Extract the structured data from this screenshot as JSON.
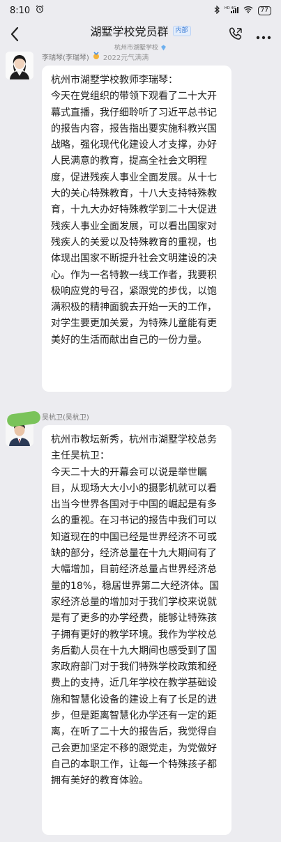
{
  "status_bar": {
    "time": "8:10",
    "network": "HD 4G",
    "battery": "77"
  },
  "header": {
    "title": "湖墅学校党员群",
    "tag": "内部",
    "subtitle": "杭州市湖墅学校"
  },
  "messages": [
    {
      "sender": "李瑞琴(李瑞琴)",
      "badge_text": "2022元气满满",
      "lines": [
        "杭州市湖墅学校教师李瑞琴：",
        "今天在党组织的带领下观看了二十大开幕式直播，我仔细聆听了习近平总书记的报告内容，报告指出要实施科教兴国战略，强化现代化建设人才支撑，办好人民满意的教育，提高全社会文明程度，促进残疾人事业全面发展。从十七大的关心特殊教育，十八大支持特殊教育，十九大办好特殊教学到二十大促进残疾人事业全面发展，可以看出国家对残疾人的关爱以及特殊教育的重视，也体现出国家不断提升社会文明建设的决心。作为一名特教一线工作者，我要积极响应党的号召，紧跟党的步伐，以饱满积极的精神面貌去开始一天的工作，对学生要更加关爱，为特殊儿童能有更美好的生活而献出自己的一份力量。"
      ]
    },
    {
      "sender": "吴杭卫(吴杭卫)",
      "lines": [
        "杭州市教坛新秀，杭州市湖墅学校总务主任吴杭卫：",
        "今天二十大的开幕会可以说是举世瞩目，从现场大大小小的摄影机就可以看出当今世界各国对于中国的崛起是有多么的重视。在习书记的报告中我们可以知道现在的中国已经是世界经济不可或缺的部分，经济总量在十九大期间有了大幅增加，目前经济总量占世界经济总量的18%，稳居世界第二大经济体。国家经济总量的增加对于我们学校来说就是有了更多的办学经费，能够让特殊孩子拥有更好的教学环境。我作为学校总务后勤人员在十九大期间也感受到了国家政府部门对于我们特殊学校政策和经费上的支持，近几年学校在教学基础设施和智慧化设备的建设上有了长足的进步，但是距离智慧化办学还有一定的距离，在听了二十大的报告后，我觉得自己会更加坚定不移的跟党走，为党做好自己的本职工作，让每一个特殊孩子都拥有美好的教育体验。"
      ]
    }
  ]
}
